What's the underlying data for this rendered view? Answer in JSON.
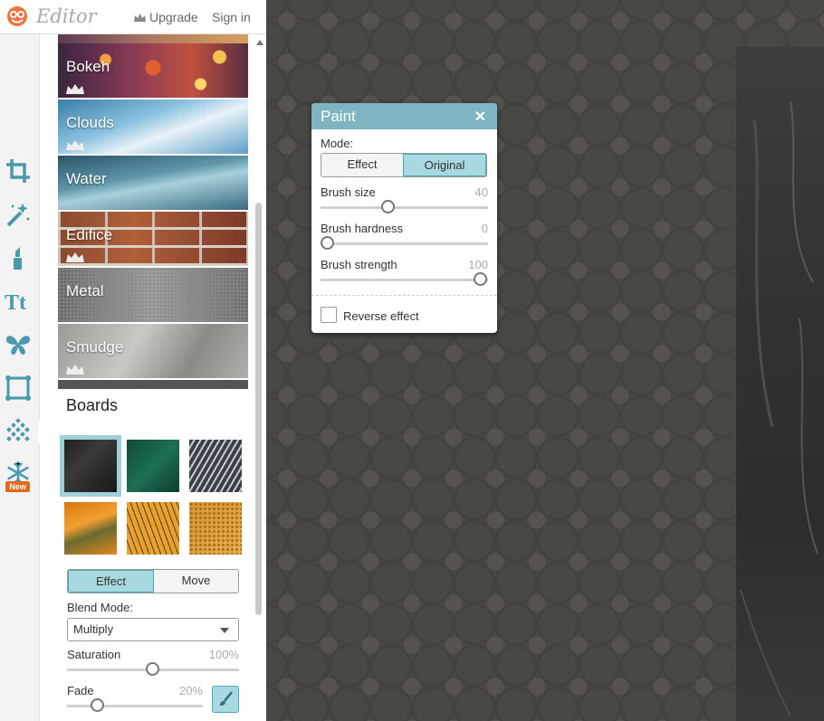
{
  "app": {
    "name": "Editor",
    "upgrade_label": "Upgrade",
    "signin_label": "Sign in"
  },
  "tools": [
    {
      "name": "crop-icon"
    },
    {
      "name": "magic-wand-icon"
    },
    {
      "name": "lipstick-icon"
    },
    {
      "name": "text-icon"
    },
    {
      "name": "butterfly-icon"
    },
    {
      "name": "frame-icon"
    },
    {
      "name": "texture-icon",
      "selected": true
    },
    {
      "name": "snowflake-icon",
      "badge": "New"
    }
  ],
  "textures": [
    {
      "label": "Bokeh",
      "premium": true
    },
    {
      "label": "Clouds",
      "premium": true
    },
    {
      "label": "Water",
      "premium": false
    },
    {
      "label": "Edifice",
      "premium": true
    },
    {
      "label": "Metal",
      "premium": false
    },
    {
      "label": "Smudge",
      "premium": true
    }
  ],
  "boards": {
    "title": "Boards",
    "selected_index": 0,
    "tab_effect": "Effect",
    "tab_move": "Move",
    "active_tab": "Effect",
    "blend_label": "Blend Mode:",
    "blend_value": "Multiply",
    "saturation_label": "Saturation",
    "saturation_value": "100%",
    "saturation_level": 0.63,
    "fade_label": "Fade",
    "fade_value": "20%",
    "fade_level": 0.2
  },
  "paint_dialog": {
    "title": "Paint",
    "close": "✕",
    "mode_label": "Mode:",
    "mode_effect": "Effect",
    "mode_original": "Original",
    "active_mode": "Original",
    "brush_size_label": "Brush size",
    "brush_size_value": "40",
    "brush_hardness_label": "Brush hardness",
    "brush_hardness_value": "0",
    "brush_strength_label": "Brush strength",
    "brush_strength_value": "100",
    "reverse_label": "Reverse effect",
    "reverse_checked": false
  },
  "colors": {
    "accent": "#7fb5c2",
    "toggle_on": "#a8d8e0",
    "badge": "#e06a1b"
  }
}
